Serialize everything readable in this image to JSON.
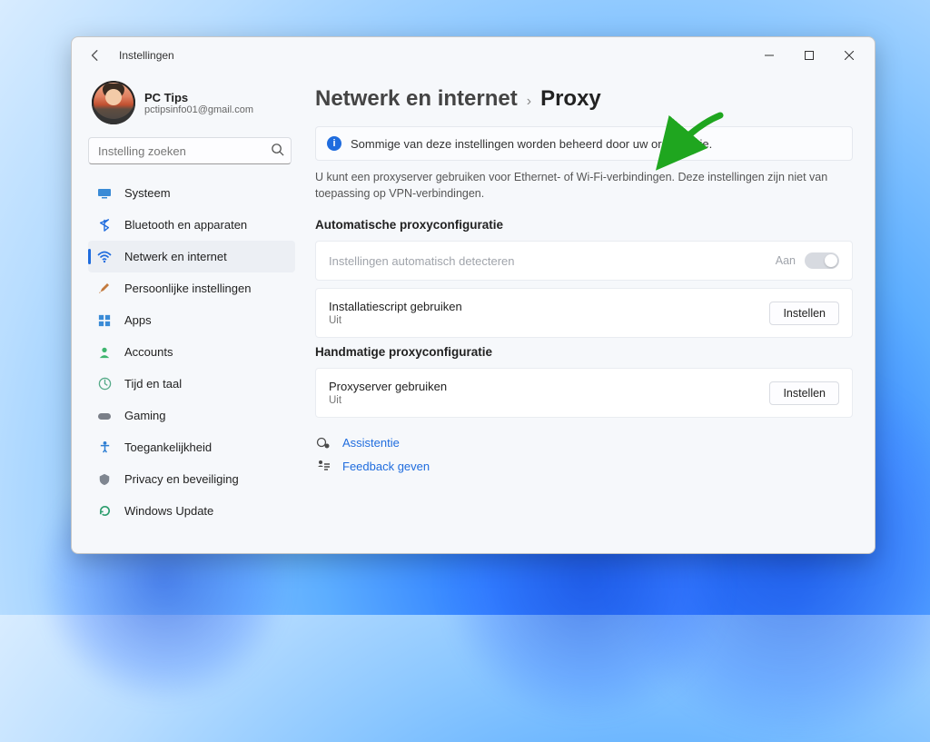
{
  "app_title": "Instellingen",
  "profile": {
    "name": "PC Tips",
    "email": "pctipsinfo01@gmail.com"
  },
  "search": {
    "placeholder": "Instelling zoeken"
  },
  "sidebar": {
    "items": [
      {
        "label": "Systeem"
      },
      {
        "label": "Bluetooth en apparaten"
      },
      {
        "label": "Netwerk en internet"
      },
      {
        "label": "Persoonlijke instellingen"
      },
      {
        "label": "Apps"
      },
      {
        "label": "Accounts"
      },
      {
        "label": "Tijd en taal"
      },
      {
        "label": "Gaming"
      },
      {
        "label": "Toegankelijkheid"
      },
      {
        "label": "Privacy en beveiliging"
      },
      {
        "label": "Windows Update"
      }
    ]
  },
  "breadcrumb": {
    "parent": "Netwerk en internet",
    "current": "Proxy"
  },
  "info_banner": "Sommige van deze instellingen worden beheerd door uw organisatie.",
  "description": "U kunt een proxyserver gebruiken voor Ethernet- of Wi-Fi-verbindingen. Deze instellingen zijn niet van toepassing op VPN-verbindingen.",
  "sections": {
    "auto": {
      "heading": "Automatische proxyconfiguratie",
      "detect": {
        "title": "Instellingen automatisch detecteren",
        "state": "Aan"
      },
      "script": {
        "title": "Installatiescript gebruiken",
        "state": "Uit",
        "button": "Instellen"
      }
    },
    "manual": {
      "heading": "Handmatige proxyconfiguratie",
      "server": {
        "title": "Proxyserver gebruiken",
        "state": "Uit",
        "button": "Instellen"
      }
    }
  },
  "links": {
    "assist": "Assistentie",
    "feedback": "Feedback geven"
  }
}
